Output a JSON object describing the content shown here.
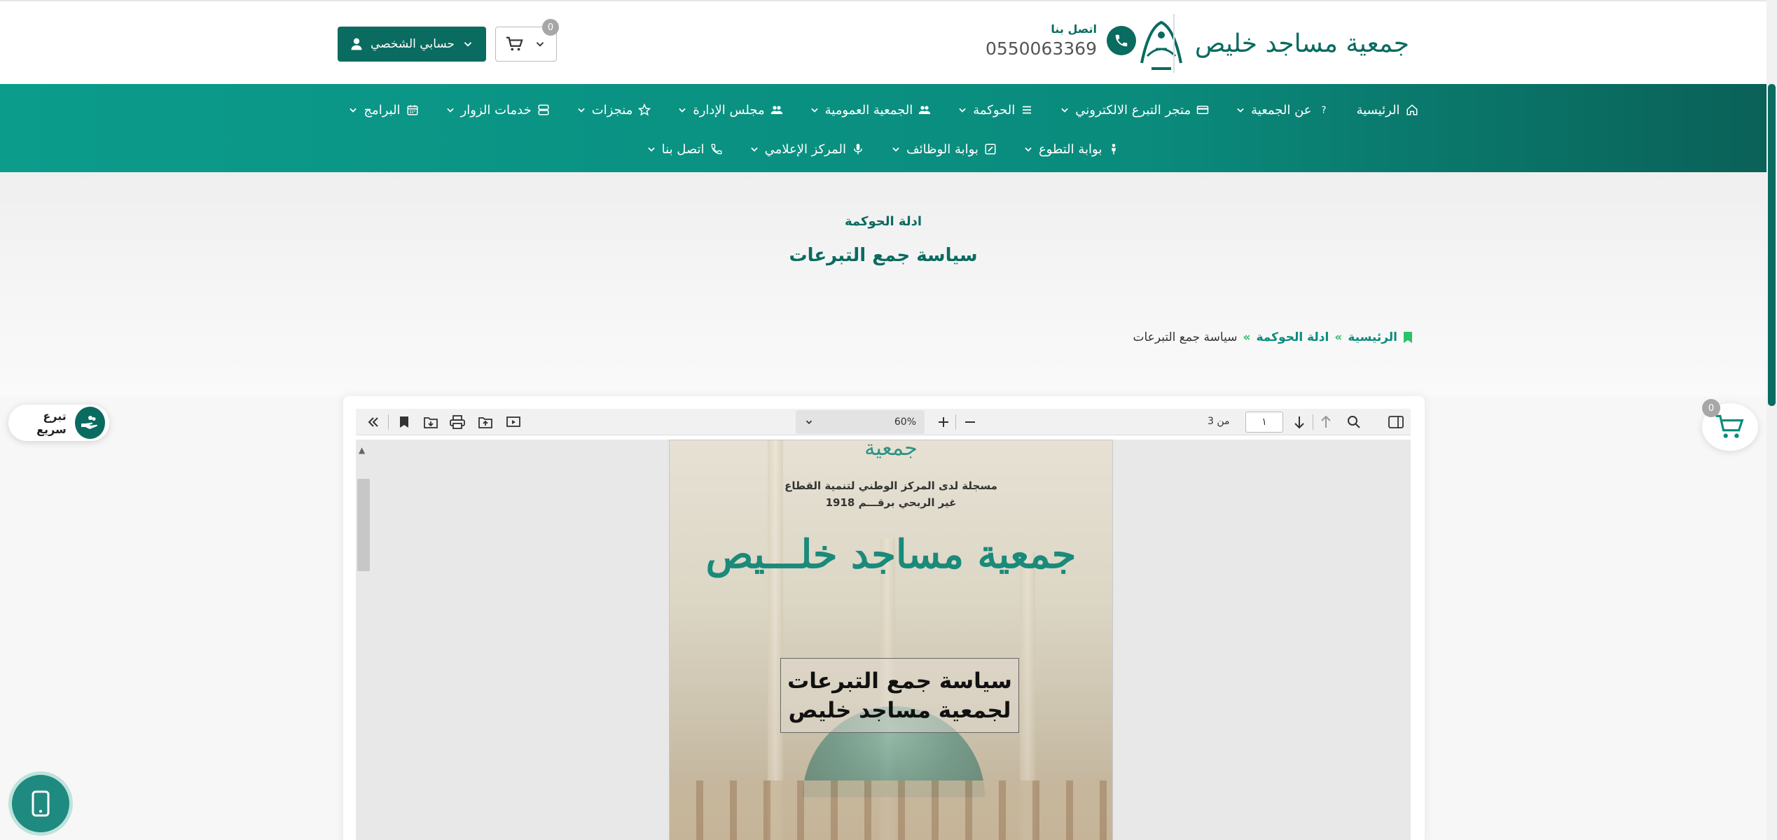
{
  "header": {
    "logo_text": "جمعية مساجد خليص",
    "contact_label": "اتصل بنا",
    "contact_number": "0550063369",
    "cart_count": "0",
    "account_label": "حسابي الشخصي"
  },
  "nav": {
    "row1": [
      {
        "label": "الرئيسية",
        "icon": "home-icon"
      },
      {
        "label": "عن الجمعية",
        "icon": "question-icon"
      },
      {
        "label": "متجر التبرع الالكتروني",
        "icon": "card-icon"
      },
      {
        "label": "الحوكمة",
        "icon": "list-icon"
      },
      {
        "label": "الجمعية العمومية",
        "icon": "users-icon"
      },
      {
        "label": "مجلس الإدارة",
        "icon": "users-icon"
      },
      {
        "label": "منجزات",
        "icon": "star-icon"
      },
      {
        "label": "خدمات الزوار",
        "icon": "server-icon"
      },
      {
        "label": "البرامج",
        "icon": "calendar-icon"
      }
    ],
    "row2": [
      {
        "label": "بوابة التطوع",
        "icon": "person-icon"
      },
      {
        "label": "بوابة الوظائف",
        "icon": "edit-icon"
      },
      {
        "label": "المركز الإعلامي",
        "icon": "mic-icon"
      },
      {
        "label": "اتصل بنا",
        "icon": "phone-icon"
      }
    ]
  },
  "hero": {
    "pre_title": "ادلة الحوكمة",
    "title": "سياسة جمع التبرعات"
  },
  "breadcrumb": {
    "home": "الرئيسية",
    "section": "ادلة الحوكمة",
    "current": "سياسة جمع التبرعات",
    "separator": "»"
  },
  "viewer": {
    "zoom": "60%",
    "page_number": "١",
    "page_of": "من 3"
  },
  "pdf": {
    "logo_text": "جمعية",
    "line1": "مسجلة لدى المركز الوطني لتنمية القطاع",
    "line2": "غير الربحي برقـــم 1918",
    "big_name": "جمعية مساجد خلـــيص",
    "box_line1": "سياسة جمع التبرعات",
    "box_line2": "لجمعية مساجد خليص"
  },
  "widgets": {
    "quick_donate": "تبرع سريع",
    "float_cart_count": "0"
  },
  "colors": {
    "brand": "#0a6b60",
    "nav_gradient_start": "#0b9c8c",
    "accent_green": "#29c36a"
  }
}
